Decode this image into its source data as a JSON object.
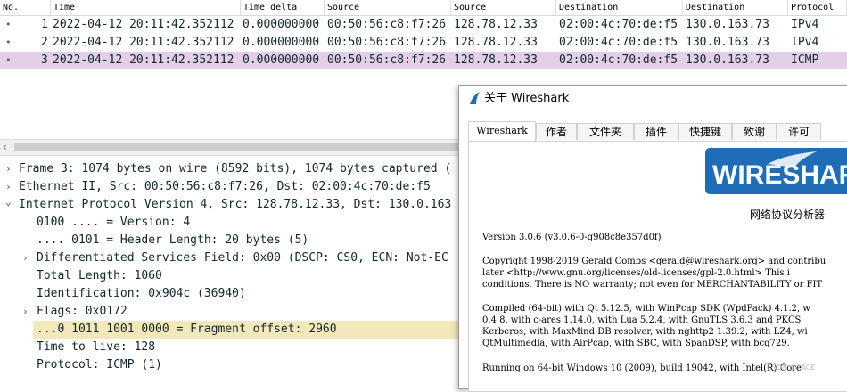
{
  "packet_list": {
    "columns": [
      "No.",
      "Time",
      "Time delta",
      "Source",
      "Source",
      "Destination",
      "Destination",
      "Protocol"
    ],
    "rows": [
      {
        "no": "1",
        "time": "2022-04-12 20:11:42.352112",
        "delta": "0.000000000",
        "src_mac": "00:50:56:c8:f7:26",
        "src_ip": "128.78.12.33",
        "dst_mac": "02:00:4c:70:de:f5",
        "dst_ip": "130.0.163.73",
        "protocol": "IPv4"
      },
      {
        "no": "2",
        "time": "2022-04-12 20:11:42.352112",
        "delta": "0.000000000",
        "src_mac": "00:50:56:c8:f7:26",
        "src_ip": "128.78.12.33",
        "dst_mac": "02:00:4c:70:de:f5",
        "dst_ip": "130.0.163.73",
        "protocol": "IPv4"
      },
      {
        "no": "3",
        "time": "2022-04-12 20:11:42.352112",
        "delta": "0.000000000",
        "src_mac": "00:50:56:c8:f7:26",
        "src_ip": "128.78.12.33",
        "dst_mac": "02:00:4c:70:de:f5",
        "dst_ip": "130.0.163.73",
        "protocol": "ICMP"
      }
    ],
    "selected_row": "3",
    "selected_color": "#e4cfe8"
  },
  "details": {
    "lines": [
      {
        "text": "Frame 3: 1074 bytes on wire (8592 bits), 1074 bytes captured (",
        "expander": "›"
      },
      {
        "text": "Ethernet II, Src: 00:50:56:c8:f7:26, Dst: 02:00:4c:70:de:f5",
        "expander": "›"
      },
      {
        "text": "Internet Protocol Version 4, Src: 128.78.12.33, Dst: 130.0.163",
        "expander": "⌄"
      },
      {
        "text": "0100 .... = Version: 4",
        "expander": ""
      },
      {
        "text": ".... 0101 = Header Length: 20 bytes (5)",
        "expander": ""
      },
      {
        "text": "Differentiated Services Field: 0x00 (DSCP: CS0, ECN: Not-EC",
        "expander": "›"
      },
      {
        "text": "Total Length: 1060",
        "expander": ""
      },
      {
        "text": "Identification: 0x904c (36940)",
        "expander": ""
      },
      {
        "text": "Flags: 0x0172",
        "expander": "›"
      },
      {
        "text": "...0 1011 1001 0000 = Fragment offset: 2960",
        "expander": ""
      },
      {
        "text": "Time to live: 128",
        "expander": ""
      },
      {
        "text": "Protocol: ICMP (1)",
        "expander": ""
      }
    ],
    "highlight_color": "#f3e8b9"
  },
  "about_dialog": {
    "title": "关于 Wireshark",
    "tabs": [
      "Wireshark",
      "作者",
      "文件夹",
      "插件",
      "快捷键",
      "致谢",
      "许可"
    ],
    "active_tab": "Wireshark",
    "logo_text": "WIRESHARK",
    "logo_color": "#1e6db6",
    "logo_subtitle": "网络协议分析器",
    "version": "Version 3.0.6 (v3.0.6-0-g908c8e357d0f)",
    "copyright_lines": [
      "Copyright 1998-2019 Gerald Combs <gerald@wireshark.org> and contribu",
      "later <http://www.gnu.org/licenses/old-licenses/gpl-2.0.html> This i",
      "conditions. There is NO warranty; not even for MERCHANTABILITY or FIT"
    ],
    "compiled_lines": [
      "Compiled (64-bit) with Qt 5.12.5, with WinPcap SDK (WpdPack) 4.1.2, w",
      "0.4.8, with c-ares 1.14.0, with Lua 5.2.4, with GnuTLS 3.6.3 and PKCS",
      "Kerberos, with MaxMind DB resolver, with nghttp2 1.39.2, with LZ4, wi",
      "QtMultimedia, with AirPcap, with SBC, with SpanDSP, with bcg729."
    ],
    "running_line": "Running on 64-bit Windows 10 (2009), build 19042, with Intel(R) Core"
  },
  "watermark": "CSDN @7ACE"
}
